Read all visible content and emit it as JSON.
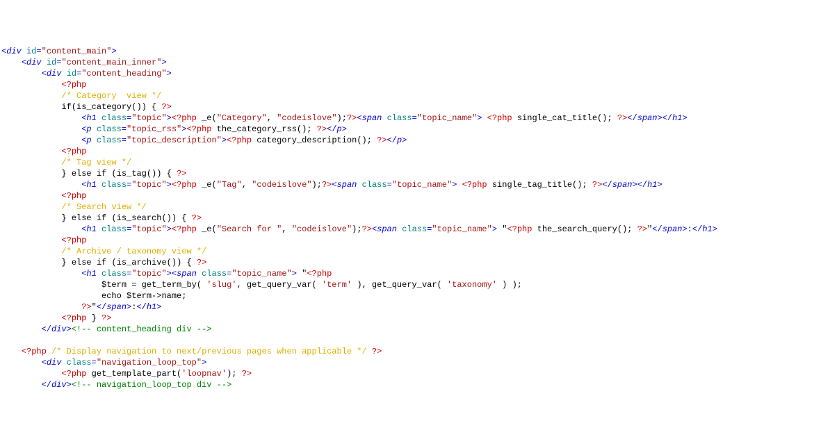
{
  "rows": [
    [
      [
        "<",
        "t"
      ],
      [
        "div",
        "e"
      ],
      [
        " ",
        "t"
      ],
      [
        "id",
        "a"
      ],
      [
        "=",
        "t"
      ],
      [
        "\"content_main\"",
        "s"
      ],
      [
        ">",
        "t"
      ]
    ],
    [
      [
        "    ",
        ""
      ],
      [
        "<",
        "t"
      ],
      [
        "div",
        "e"
      ],
      [
        " ",
        "t"
      ],
      [
        "id",
        "a"
      ],
      [
        "=",
        "t"
      ],
      [
        "\"content_main_inner\"",
        "s"
      ],
      [
        ">",
        "t"
      ]
    ],
    [
      [
        "        ",
        ""
      ],
      [
        "<",
        "t"
      ],
      [
        "div",
        "e"
      ],
      [
        " ",
        "t"
      ],
      [
        "id",
        "a"
      ],
      [
        "=",
        "t"
      ],
      [
        "\"content_heading\"",
        "s"
      ],
      [
        ">",
        "t"
      ]
    ],
    [
      [
        "            ",
        ""
      ],
      [
        "<?php",
        "p"
      ]
    ],
    [
      [
        "            ",
        ""
      ],
      [
        "/* Category  view */",
        "c"
      ]
    ],
    [
      [
        "            ",
        ""
      ],
      [
        "if",
        "k"
      ],
      [
        "(is_category()) { ",
        "k"
      ],
      [
        "?>",
        "p"
      ]
    ],
    [
      [
        "                ",
        ""
      ],
      [
        "<",
        "t"
      ],
      [
        "h1",
        "e"
      ],
      [
        " ",
        "t"
      ],
      [
        "class",
        "a"
      ],
      [
        "=",
        "t"
      ],
      [
        "\"topic\"",
        "s"
      ],
      [
        ">",
        "t"
      ],
      [
        "<?php",
        "p"
      ],
      [
        " _e(",
        "k"
      ],
      [
        "\"Category\"",
        "s"
      ],
      [
        ", ",
        "k"
      ],
      [
        "\"codeislove\"",
        "s"
      ],
      [
        ");",
        "k"
      ],
      [
        "?>",
        "p"
      ],
      [
        "<",
        "t"
      ],
      [
        "span",
        "e"
      ],
      [
        " ",
        "t"
      ],
      [
        "class",
        "a"
      ],
      [
        "=",
        "t"
      ],
      [
        "\"topic_name\"",
        "s"
      ],
      [
        ">",
        "t"
      ],
      [
        " ",
        "k"
      ],
      [
        "<?php",
        "p"
      ],
      [
        " single_cat_title(); ",
        "k"
      ],
      [
        "?>",
        "p"
      ],
      [
        "</",
        "t"
      ],
      [
        "span",
        "e"
      ],
      [
        ">",
        "t"
      ],
      [
        "</",
        "t"
      ],
      [
        "h1",
        "e"
      ],
      [
        ">",
        "t"
      ]
    ],
    [
      [
        "                ",
        ""
      ],
      [
        "<",
        "t"
      ],
      [
        "p",
        "e"
      ],
      [
        " ",
        "t"
      ],
      [
        "class",
        "a"
      ],
      [
        "=",
        "t"
      ],
      [
        "\"topic_rss\"",
        "s"
      ],
      [
        ">",
        "t"
      ],
      [
        "<?php",
        "p"
      ],
      [
        " the_category_rss(); ",
        "k"
      ],
      [
        "?>",
        "p"
      ],
      [
        "</",
        "t"
      ],
      [
        "p",
        "e"
      ],
      [
        ">",
        "t"
      ]
    ],
    [
      [
        "                ",
        ""
      ],
      [
        "<",
        "t"
      ],
      [
        "p",
        "e"
      ],
      [
        " ",
        "t"
      ],
      [
        "class",
        "a"
      ],
      [
        "=",
        "t"
      ],
      [
        "\"topic_description\"",
        "s"
      ],
      [
        ">",
        "t"
      ],
      [
        "<?php",
        "p"
      ],
      [
        " category_description(); ",
        "k"
      ],
      [
        "?>",
        "p"
      ],
      [
        "</",
        "t"
      ],
      [
        "p",
        "e"
      ],
      [
        ">",
        "t"
      ]
    ],
    [
      [
        "            ",
        ""
      ],
      [
        "<?php",
        "p"
      ]
    ],
    [
      [
        "            ",
        ""
      ],
      [
        "/* Tag view */",
        "c"
      ]
    ],
    [
      [
        "            ",
        ""
      ],
      [
        "} ",
        "k"
      ],
      [
        "else",
        "k"
      ],
      [
        " ",
        "k"
      ],
      [
        "if",
        "k"
      ],
      [
        " (is_tag()) { ",
        "k"
      ],
      [
        "?>",
        "p"
      ]
    ],
    [
      [
        "                ",
        ""
      ],
      [
        "<",
        "t"
      ],
      [
        "h1",
        "e"
      ],
      [
        " ",
        "t"
      ],
      [
        "class",
        "a"
      ],
      [
        "=",
        "t"
      ],
      [
        "\"topic\"",
        "s"
      ],
      [
        ">",
        "t"
      ],
      [
        "<?php",
        "p"
      ],
      [
        " _e(",
        "k"
      ],
      [
        "\"Tag\"",
        "s"
      ],
      [
        ", ",
        "k"
      ],
      [
        "\"codeislove\"",
        "s"
      ],
      [
        ");",
        "k"
      ],
      [
        "?>",
        "p"
      ],
      [
        "<",
        "t"
      ],
      [
        "span",
        "e"
      ],
      [
        " ",
        "t"
      ],
      [
        "class",
        "a"
      ],
      [
        "=",
        "t"
      ],
      [
        "\"topic_name\"",
        "s"
      ],
      [
        ">",
        "t"
      ],
      [
        " ",
        "k"
      ],
      [
        "<?php",
        "p"
      ],
      [
        " single_tag_title(); ",
        "k"
      ],
      [
        "?>",
        "p"
      ],
      [
        "</",
        "t"
      ],
      [
        "span",
        "e"
      ],
      [
        ">",
        "t"
      ],
      [
        "</",
        "t"
      ],
      [
        "h1",
        "e"
      ],
      [
        ">",
        "t"
      ]
    ],
    [
      [
        "            ",
        ""
      ],
      [
        "<?php",
        "p"
      ]
    ],
    [
      [
        "            ",
        ""
      ],
      [
        "/* Search view */",
        "c"
      ]
    ],
    [
      [
        "            ",
        ""
      ],
      [
        "} ",
        "k"
      ],
      [
        "else",
        "k"
      ],
      [
        " ",
        "k"
      ],
      [
        "if",
        "k"
      ],
      [
        " (is_search()) { ",
        "k"
      ],
      [
        "?>",
        "p"
      ]
    ],
    [
      [
        "                ",
        ""
      ],
      [
        "<",
        "t"
      ],
      [
        "h1",
        "e"
      ],
      [
        " ",
        "t"
      ],
      [
        "class",
        "a"
      ],
      [
        "=",
        "t"
      ],
      [
        "\"topic\"",
        "s"
      ],
      [
        ">",
        "t"
      ],
      [
        "<?php",
        "p"
      ],
      [
        " _e(",
        "k"
      ],
      [
        "\"Search for \"",
        "s"
      ],
      [
        ", ",
        "k"
      ],
      [
        "\"codeislove\"",
        "s"
      ],
      [
        ");",
        "k"
      ],
      [
        "?>",
        "p"
      ],
      [
        "<",
        "t"
      ],
      [
        "span",
        "e"
      ],
      [
        " ",
        "t"
      ],
      [
        "class",
        "a"
      ],
      [
        "=",
        "t"
      ],
      [
        "\"topic_name\"",
        "s"
      ],
      [
        ">",
        "t"
      ],
      [
        " \"",
        "k"
      ],
      [
        "<?php",
        "p"
      ],
      [
        " the_search_query(); ",
        "k"
      ],
      [
        "?>",
        "p"
      ],
      [
        "\"",
        "k"
      ],
      [
        "</",
        "t"
      ],
      [
        "span",
        "e"
      ],
      [
        ">",
        "t"
      ],
      [
        ":",
        "k"
      ],
      [
        "</",
        "t"
      ],
      [
        "h1",
        "e"
      ],
      [
        ">",
        "t"
      ]
    ],
    [
      [
        "            ",
        ""
      ],
      [
        "<?php",
        "p"
      ]
    ],
    [
      [
        "            ",
        ""
      ],
      [
        "/* Archive / taxonomy view */",
        "c"
      ]
    ],
    [
      [
        "            ",
        ""
      ],
      [
        "} ",
        "k"
      ],
      [
        "else",
        "k"
      ],
      [
        " ",
        "k"
      ],
      [
        "if",
        "k"
      ],
      [
        " (is_archive()) { ",
        "k"
      ],
      [
        "?>",
        "p"
      ]
    ],
    [
      [
        "                ",
        ""
      ],
      [
        "<",
        "t"
      ],
      [
        "h1",
        "e"
      ],
      [
        " ",
        "t"
      ],
      [
        "class",
        "a"
      ],
      [
        "=",
        "t"
      ],
      [
        "\"topic\"",
        "s"
      ],
      [
        ">",
        "t"
      ],
      [
        "<",
        "t"
      ],
      [
        "span",
        "e"
      ],
      [
        " ",
        "t"
      ],
      [
        "class",
        "a"
      ],
      [
        "=",
        "t"
      ],
      [
        "\"topic_name\"",
        "s"
      ],
      [
        ">",
        "t"
      ],
      [
        " \"",
        "k"
      ],
      [
        "<?php",
        "p"
      ]
    ],
    [
      [
        "                    ",
        ""
      ],
      [
        "$term = get_term_by( ",
        "k"
      ],
      [
        "'slug'",
        "s"
      ],
      [
        ", get_query_var( ",
        "k"
      ],
      [
        "'term'",
        "s"
      ],
      [
        " ), get_query_var( ",
        "k"
      ],
      [
        "'taxonomy'",
        "s"
      ],
      [
        " ) );",
        "k"
      ]
    ],
    [
      [
        "                    ",
        ""
      ],
      [
        "echo",
        "k"
      ],
      [
        " $term->name;",
        "k"
      ]
    ],
    [
      [
        "                ",
        ""
      ],
      [
        "?>",
        "p"
      ],
      [
        "\"",
        "k"
      ],
      [
        "</",
        "t"
      ],
      [
        "span",
        "e"
      ],
      [
        ">",
        "t"
      ],
      [
        ":",
        "k"
      ],
      [
        "</",
        "t"
      ],
      [
        "h1",
        "e"
      ],
      [
        ">",
        "t"
      ]
    ],
    [
      [
        "            ",
        ""
      ],
      [
        "<?php",
        "p"
      ],
      [
        " } ",
        "k"
      ],
      [
        "?>",
        "p"
      ]
    ],
    [
      [
        "        ",
        ""
      ],
      [
        "</",
        "t"
      ],
      [
        "div",
        "e"
      ],
      [
        ">",
        "t"
      ],
      [
        "<!-- content_heading div -->",
        "hc"
      ]
    ],
    [
      [
        "",
        ""
      ]
    ],
    [
      [
        "    ",
        ""
      ],
      [
        "<?php",
        "p"
      ],
      [
        " ",
        "k"
      ],
      [
        "/* Display navigation to next/previous pages when applicable */",
        "c"
      ],
      [
        " ",
        "k"
      ],
      [
        "?>",
        "p"
      ]
    ],
    [
      [
        "        ",
        ""
      ],
      [
        "<",
        "t"
      ],
      [
        "div",
        "e"
      ],
      [
        " ",
        "t"
      ],
      [
        "class",
        "a"
      ],
      [
        "=",
        "t"
      ],
      [
        "\"navigation_loop_top\"",
        "s"
      ],
      [
        ">",
        "t"
      ]
    ],
    [
      [
        "            ",
        ""
      ],
      [
        "<?php",
        "p"
      ],
      [
        " get_template_part(",
        "k"
      ],
      [
        "'loopnav'",
        "s"
      ],
      [
        "); ",
        "k"
      ],
      [
        "?>",
        "p"
      ]
    ],
    [
      [
        "        ",
        ""
      ],
      [
        "</",
        "t"
      ],
      [
        "div",
        "e"
      ],
      [
        ">",
        "t"
      ],
      [
        "<!-- navigation_loop_top div -->",
        "hc"
      ]
    ]
  ]
}
